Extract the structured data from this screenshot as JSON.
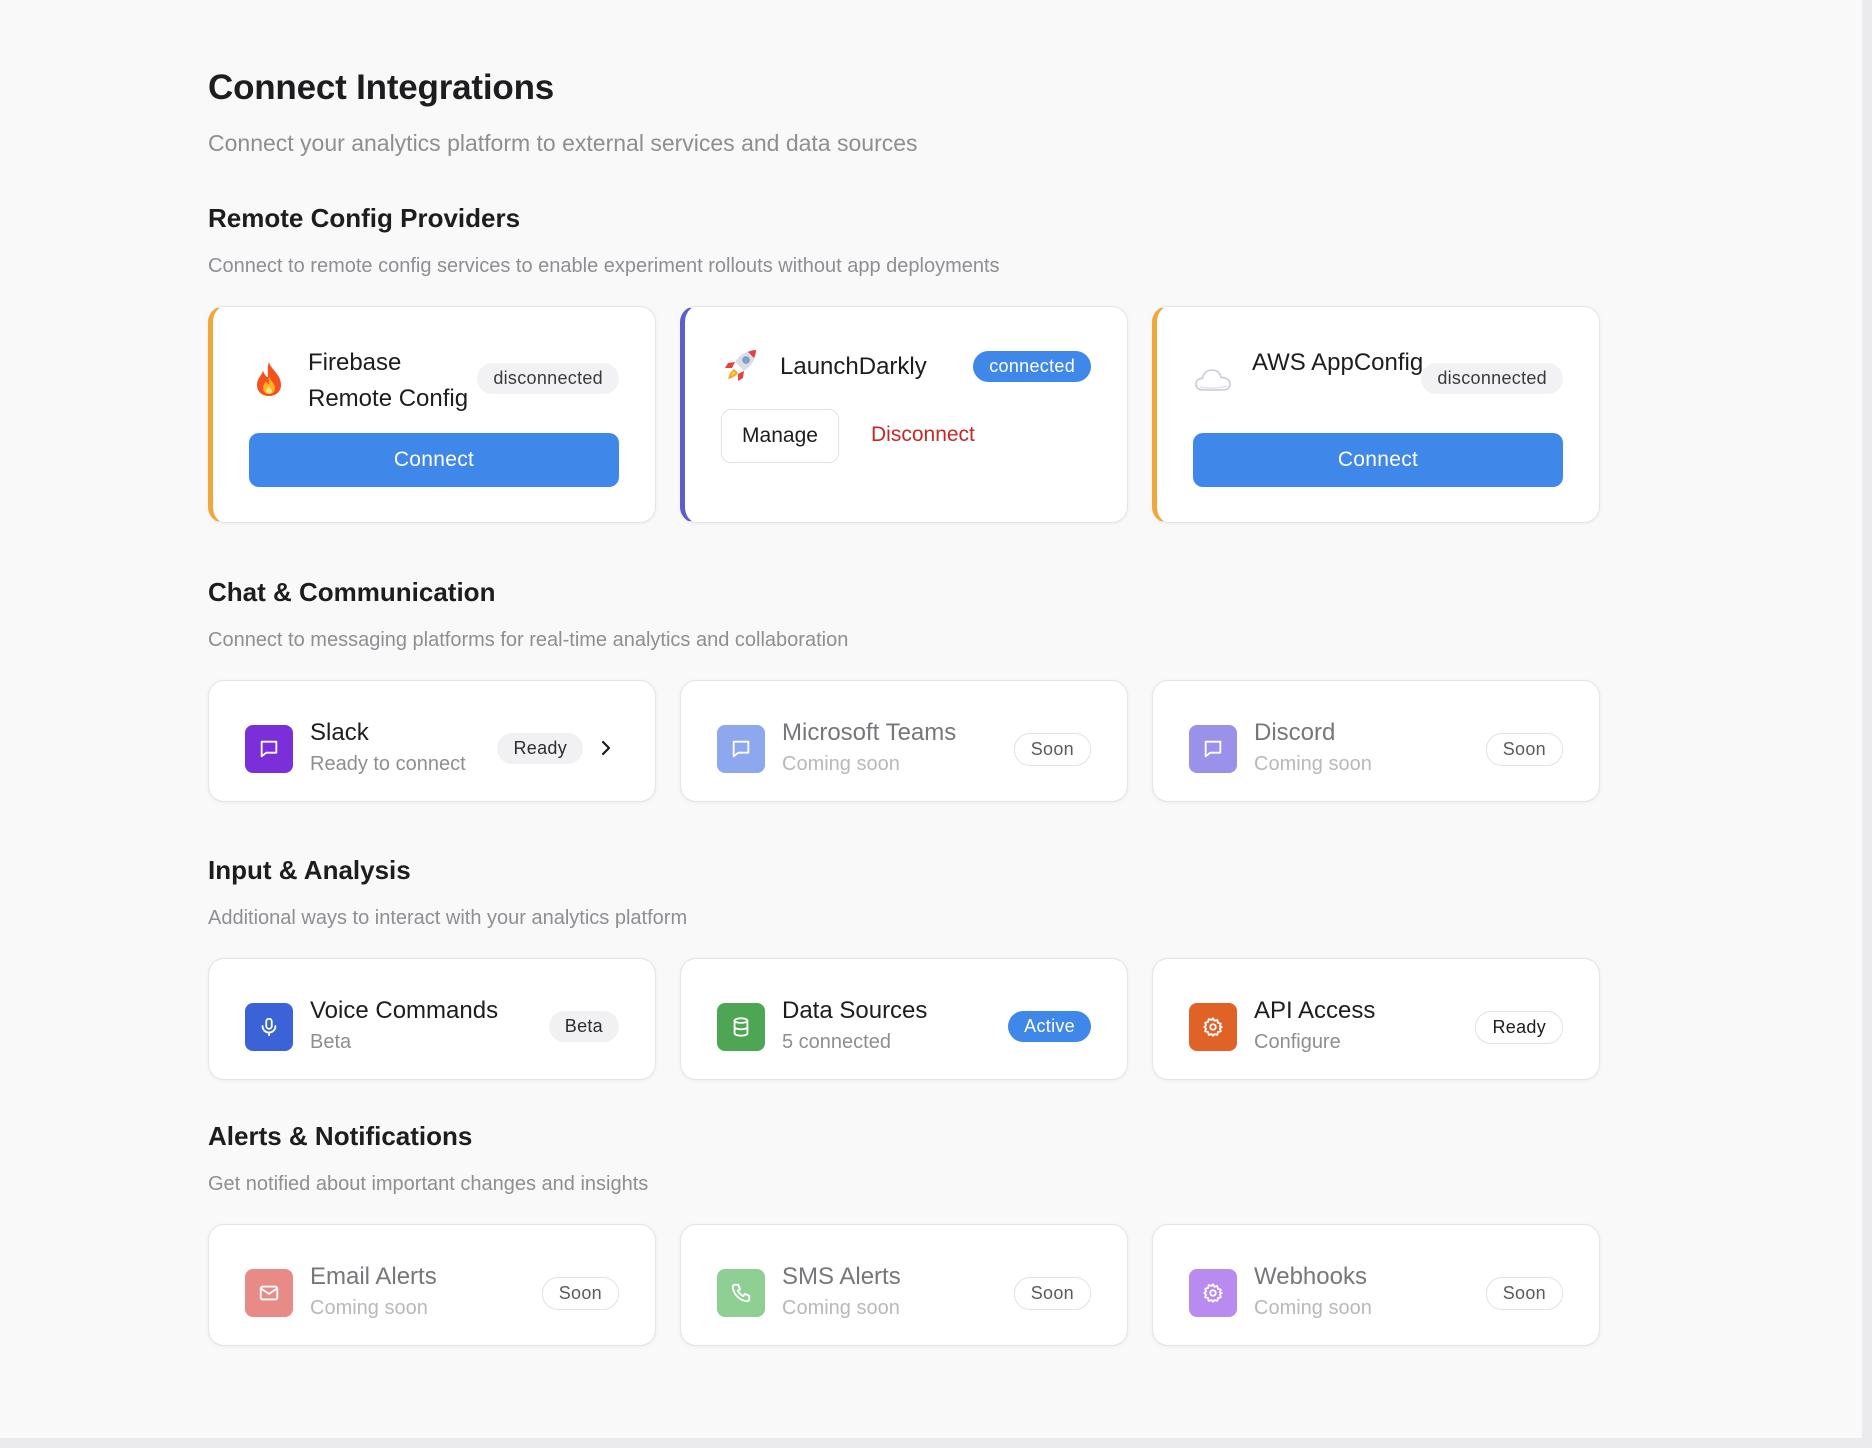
{
  "header": {
    "title": "Connect Integrations",
    "subtitle": "Connect your analytics platform to external services and data sources"
  },
  "colors": {
    "primary": "#3f87e8",
    "accent_orange": "#f0a73c",
    "accent_indigo": "#5b5fc7",
    "danger": "#c62828"
  },
  "sections": {
    "remote": {
      "title": "Remote Config Providers",
      "description": "Connect to remote config services to enable experiment rollouts without app deployments",
      "cards": [
        {
          "name": "Firebase Remote Config",
          "icon": "fire-icon",
          "status": "disconnected",
          "action": "Connect"
        },
        {
          "name": "LaunchDarkly",
          "icon": "rocket-icon",
          "status": "connected",
          "manage": "Manage",
          "disconnect": "Disconnect"
        },
        {
          "name": "AWS AppConfig",
          "icon": "cloud-icon",
          "status": "disconnected",
          "action": "Connect"
        }
      ]
    },
    "chat": {
      "title": "Chat & Communication",
      "description": "Connect to messaging platforms for real-time analytics and collaboration",
      "cards": [
        {
          "title": "Slack",
          "subtitle": "Ready to connect",
          "badge": "Ready",
          "icon": "message-icon",
          "color": "#7b2fd8"
        },
        {
          "title": "Microsoft Teams",
          "subtitle": "Coming soon",
          "badge": "Soon",
          "icon": "message-icon",
          "color": "#8ea8f0"
        },
        {
          "title": "Discord",
          "subtitle": "Coming soon",
          "badge": "Soon",
          "icon": "message-icon",
          "color": "#9a92ea"
        }
      ]
    },
    "input": {
      "title": "Input & Analysis",
      "description": "Additional ways to interact with your analytics platform",
      "cards": [
        {
          "title": "Voice Commands",
          "subtitle": "Beta",
          "badge": "Beta",
          "icon": "microphone-icon",
          "color": "#3a63d8"
        },
        {
          "title": "Data Sources",
          "subtitle": "5 connected",
          "badge": "Active",
          "icon": "database-icon",
          "color": "#4ea655"
        },
        {
          "title": "API Access",
          "subtitle": "Configure",
          "badge": "Ready",
          "icon": "gear-icon",
          "color": "#e06226"
        }
      ]
    },
    "alerts": {
      "title": "Alerts & Notifications",
      "description": "Get notified about important changes and insights",
      "cards": [
        {
          "title": "Email Alerts",
          "subtitle": "Coming soon",
          "badge": "Soon",
          "icon": "mail-icon",
          "color": "#e88b86"
        },
        {
          "title": "SMS Alerts",
          "subtitle": "Coming soon",
          "badge": "Soon",
          "icon": "phone-icon",
          "color": "#8fcf94"
        },
        {
          "title": "Webhooks",
          "subtitle": "Coming soon",
          "badge": "Soon",
          "icon": "gear-icon",
          "color": "#b98af0"
        }
      ]
    }
  }
}
